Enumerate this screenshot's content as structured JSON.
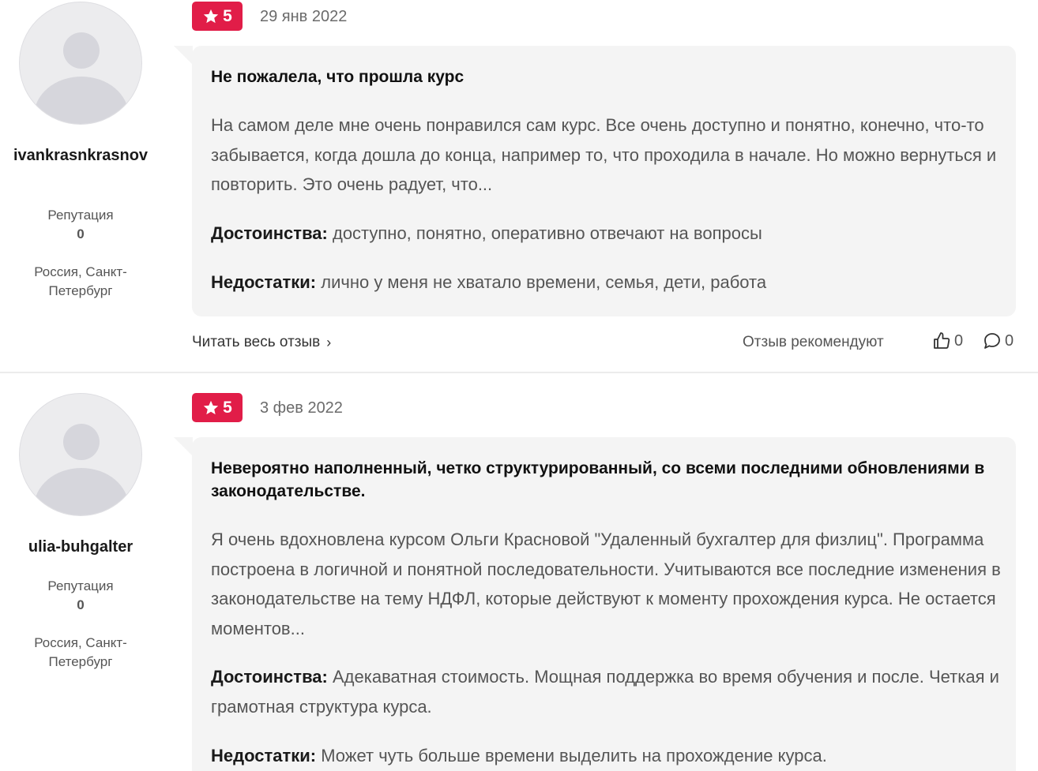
{
  "reviews": [
    {
      "author": "ivankrasnkrasnov",
      "reputation_label": "Репутация",
      "reputation_value": "0",
      "location": "Россия, Санкт-Петербург",
      "rating": "5",
      "date": "29 янв 2022",
      "title": "Не пожалела, что прошла курс",
      "text": "На самом деле мне очень понравился сам курс. Все очень доступно и понятно, конечно, что-то забывается, когда дошла до конца, например то, что проходила в начале. Но можно вернуться и повторить. Это очень радует, что...",
      "pros_label": "Достоинства:",
      "pros": " доступно, понятно, оперативно отвечают на вопросы",
      "cons_label": "Недостатки:",
      "cons": " лично у меня не хватало времени, семья, дети, работа",
      "read_more": "Читать весь отзыв",
      "recommend_label": "Отзыв рекомендуют",
      "likes": "0",
      "comments": "0"
    },
    {
      "author": "ulia-buhgalter",
      "reputation_label": "Репутация",
      "reputation_value": "0",
      "location": "Россия, Санкт-Петербург",
      "rating": "5",
      "date": "3 фев 2022",
      "title": "Невероятно наполненный, четко структурированный, со всеми последними обновлениями в законодательстве.",
      "text": "Я очень вдохновлена курсом Ольги Красновой \"Удаленный бухгалтер для физлиц\". Программа построена в логичной и понятной последовательности. Учитываются все последние изменения в законодательстве на тему НДФЛ, которые действуют к моменту прохождения курса. Не остается моментов...",
      "pros_label": "Достоинства:",
      "pros": " Адекаватная стоимость. Мощная поддержка во время обучения и после. Четкая и грамотная структура курса.",
      "cons_label": "Недостатки:",
      "cons": " Может чуть больше времени выделить на прохождение курса."
    }
  ],
  "colors": {
    "badge": "#e11d48",
    "bubble": "#f4f4f4"
  },
  "icons": {
    "rating": "star-icon",
    "like": "thumbs-up-icon",
    "comment": "comment-icon",
    "chevron": "chevron-right-icon"
  }
}
